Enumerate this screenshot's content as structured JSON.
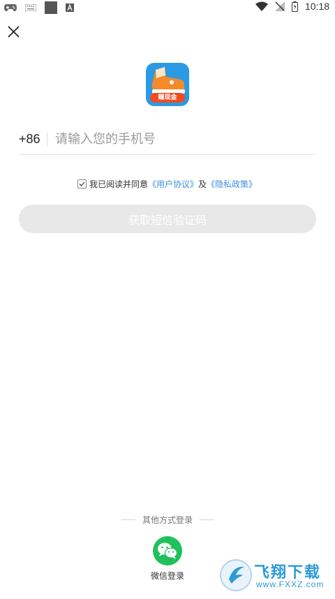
{
  "status_bar": {
    "time": "10:18",
    "left_icons": [
      "gamepad-icon",
      "keyboard-icon",
      "square-icon",
      "font-icon"
    ],
    "right_icons": [
      "wifi-icon",
      "no-signal-icon",
      "battery-icon"
    ]
  },
  "close_icon": "close-icon",
  "logo": {
    "badge_text": "赚现金"
  },
  "phone": {
    "country_code": "+86",
    "placeholder": "请输入您的手机号",
    "value": ""
  },
  "agreement": {
    "checked": true,
    "prefix": "我已阅读并同意",
    "user_agreement": "《用户协议》",
    "and": "及",
    "privacy_policy": "《隐私政策》"
  },
  "code_button": {
    "label": "获取短信验证码",
    "enabled": false
  },
  "other_login": {
    "label": "其他方式登录",
    "wechat_label": "微信登录"
  },
  "watermark": {
    "text": "飞翔下载",
    "url": "www.FXXZ.com"
  },
  "colors": {
    "link": "#3b8ee0",
    "wechat": "#20c15a",
    "button_disabled": "#e8e8e8",
    "logo_bg": "#2a9ae5",
    "badge": "#f04b1e"
  }
}
